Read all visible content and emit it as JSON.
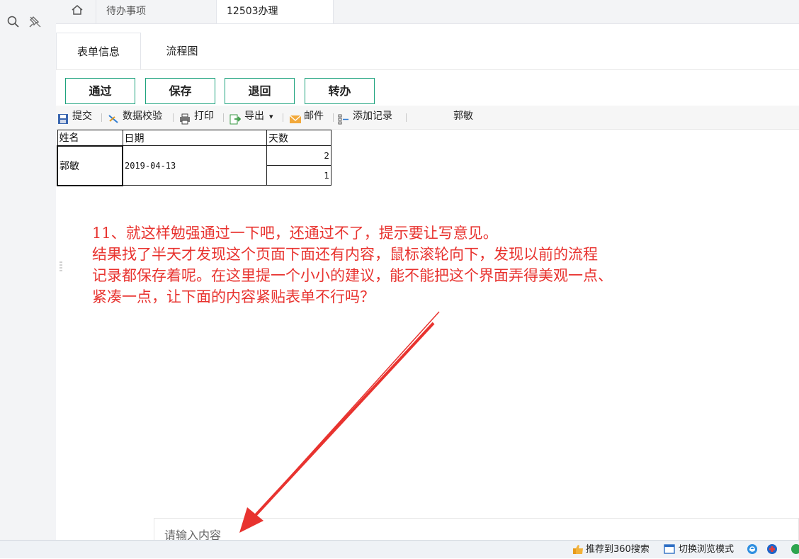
{
  "sidebar": {
    "search_icon": "search-icon",
    "pin_icon": "unpin-icon"
  },
  "top_tabs": {
    "home_icon": "home-icon",
    "todo_label": "待办事项",
    "active_label": "12503办理"
  },
  "sub_tabs": {
    "form_label": "表单信息",
    "flow_label": "流程图"
  },
  "actions": {
    "approve": "通过",
    "save": "保存",
    "return": "退回",
    "transfer": "转办"
  },
  "toolbar": {
    "submit": "提交",
    "validate": "数据校验",
    "print": "打印",
    "export": "导出",
    "export_caret": "▾",
    "mail": "邮件",
    "add_record": "添加记录",
    "user": "郭敏"
  },
  "table": {
    "headers": [
      "姓名",
      "日期",
      "天数"
    ],
    "name": "郭敏",
    "date": "2019-04-13",
    "days": [
      "2",
      "1"
    ]
  },
  "annotation": {
    "lines": [
      "11、就这样勉强通过一下吧，还通过不了，提示要让写意见。",
      "结果找了半天才发现这个页面下面还有内容，鼠标滚轮向下，发现以前的流程",
      "记录都保存着呢。在这里提一个小小的建议，能不能把这个界面弄得美观一点、",
      "紧凑一点，让下面的内容紧贴表单不行吗？"
    ],
    "color": "#e8332f"
  },
  "comment_input": {
    "placeholder": "请输入内容"
  },
  "statusbar": {
    "recommend": "推荐到360搜索",
    "switch_mode": "切换浏览模式"
  },
  "colors": {
    "accent_green": "#1fa37e",
    "annotation_red": "#e8332f"
  }
}
